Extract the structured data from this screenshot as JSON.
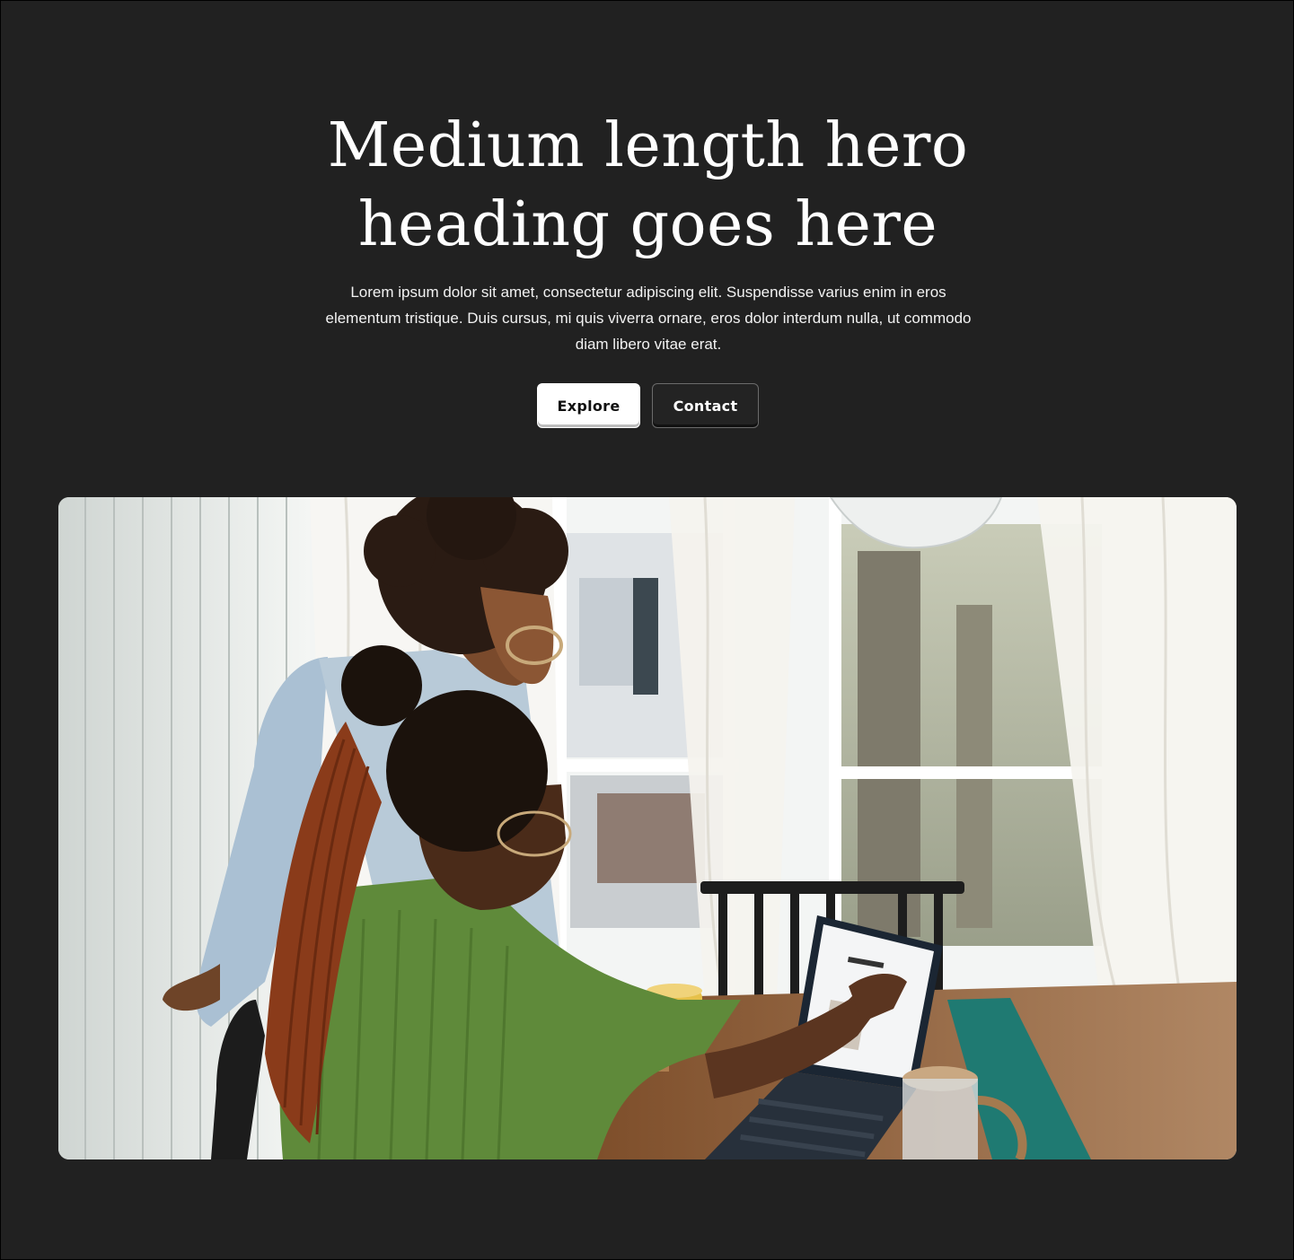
{
  "hero": {
    "heading_line1": "Medium length hero",
    "heading_line2": "heading goes here",
    "subheading": "Lorem ipsum dolor sit amet, consectetur adipiscing elit. Suspendisse varius enim in eros elementum tristique. Duis cursus, mi quis viverra ornare, eros dolor interdum nulla, ut commodo diam libero vitae erat.",
    "buttons": {
      "primary_label": "Explore",
      "secondary_label": "Contact"
    },
    "image": {
      "alt": "hero-photo"
    }
  },
  "colors": {
    "background": "#212121",
    "text": "#ffffff",
    "primary_button_bg": "#ffffff",
    "secondary_button_bg": "#232323"
  }
}
